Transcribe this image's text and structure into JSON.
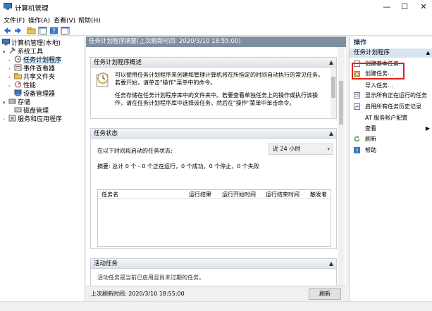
{
  "window": {
    "title": "计算机管理",
    "minimize": "—",
    "maximize": "☐",
    "close": "✕"
  },
  "menu": [
    "文件(F)",
    "操作(A)",
    "查看(V)",
    "帮助(H)"
  ],
  "tree": {
    "root": "计算机管理(本地)",
    "system_tools": "系统工具",
    "task_scheduler": "任务计划程序",
    "event_viewer": "事件查看器",
    "shared_folders": "共享文件夹",
    "performance": "性能",
    "device_manager": "设备管理器",
    "storage": "存储",
    "disk_management": "磁盘管理",
    "services_apps": "服务和应用程序"
  },
  "center": {
    "header": "任务计划程序摘要(上次刷新时间: 2020/3/10 18:55:00)",
    "overview": {
      "title": "任务计划程序概述",
      "para1": "可以使用任务计划程序来创建和管理计算机将在所指定的时间自动执行的常见任务。若要开始，请单击\"操作\"菜单中的命令。",
      "para2": "任务存储在任务计划程序库中的文件夹中。若要查看单独任务上的操作或执行该操作，请在任务计划程序库中选择该任务，然后在\"操作\"菜单中单击命令。"
    },
    "status": {
      "title": "任务状态",
      "label": "在以下时间段启动的任务状态:",
      "range": "近 24 小时",
      "summary": "摘要: 总计 0 个 - 0 个正在运行，0 个成功，0 个停止，0 个失败",
      "columns": [
        "任务名",
        "运行结果",
        "运行开始时间",
        "运行结束时间",
        "触发者"
      ]
    },
    "active": {
      "title": "活动任务",
      "text": "活动任务是当前已启用且尚未过期的任务。"
    },
    "footer": {
      "last_refresh": "上次刷新时间: 2020/3/10 18:55:00",
      "refresh_btn": "刷新"
    }
  },
  "actions": {
    "title": "操作",
    "group": "任务计划程序",
    "items": [
      "创建基本任务...",
      "创建任务...",
      "导入任务...",
      "显示所有正在运行的任务",
      "启用所有任务历史记录",
      "AT 服务帐户配置",
      "查看",
      "刷新",
      "帮助"
    ]
  },
  "colors": {
    "accent": "#0078d7",
    "highlight": "#e02020",
    "selection": "#cce8ff"
  }
}
